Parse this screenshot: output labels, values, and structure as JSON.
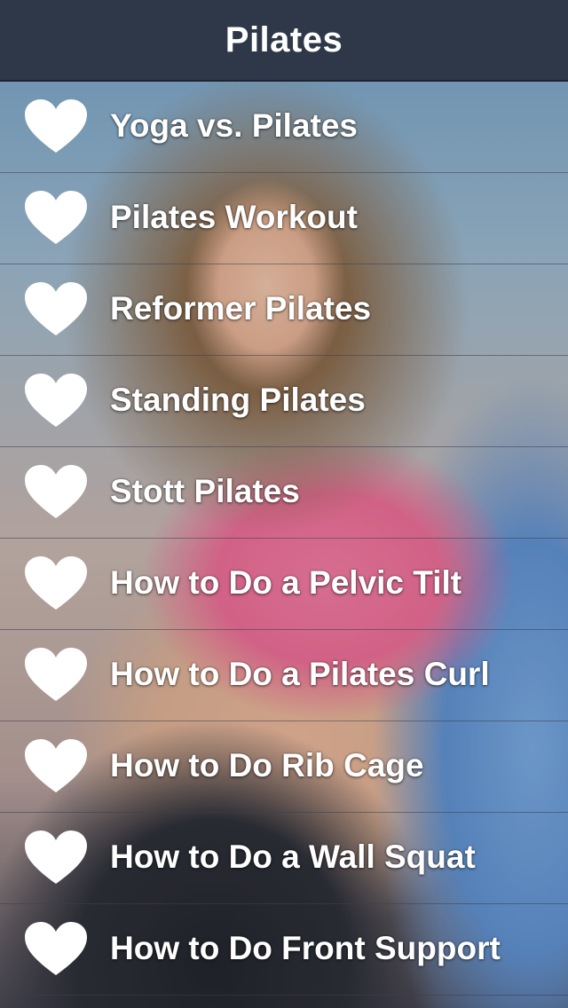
{
  "header": {
    "title": "Pilates"
  },
  "list": {
    "items": [
      {
        "label": "Yoga vs. Pilates",
        "icon": "heart-icon"
      },
      {
        "label": "Pilates Workout",
        "icon": "heart-icon"
      },
      {
        "label": "Reformer Pilates",
        "icon": "heart-icon"
      },
      {
        "label": "Standing Pilates",
        "icon": "heart-icon"
      },
      {
        "label": "Stott Pilates",
        "icon": "heart-icon"
      },
      {
        "label": "How to Do a Pelvic Tilt",
        "icon": "heart-icon"
      },
      {
        "label": "How to Do a Pilates Curl",
        "icon": "heart-icon"
      },
      {
        "label": "How to Do Rib Cage",
        "icon": "heart-icon"
      },
      {
        "label": "How to Do a Wall Squat",
        "icon": "heart-icon"
      },
      {
        "label": "How to Do Front Support",
        "icon": "heart-icon"
      }
    ]
  },
  "colors": {
    "header_bg": "#2f3848",
    "text": "#ffffff",
    "icon": "#ffffff"
  }
}
